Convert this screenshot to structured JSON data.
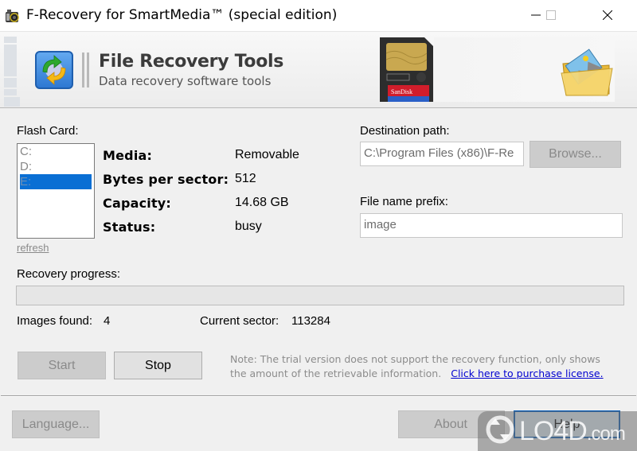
{
  "window": {
    "title": "F-Recovery for SmartMedia™ (special edition)",
    "app_icon": "camera-icon",
    "controls": [
      "minimize-icon",
      "maximize-icon",
      "close-icon"
    ]
  },
  "banner": {
    "brand_title": "File Recovery Tools",
    "brand_subtitle": "Data recovery software tools",
    "logo_icon": "recovery-arrows-icon",
    "card_icon": "smartmedia-card-icon",
    "card_text": "SanDisk",
    "folder_icon": "image-folder-icon"
  },
  "flash_card": {
    "label": "Flash Card:",
    "drives": [
      {
        "label": "C:",
        "selected": false
      },
      {
        "label": "D:",
        "selected": false
      },
      {
        "label": "E:",
        "selected": true
      }
    ],
    "refresh_label": "refresh"
  },
  "properties": [
    {
      "key": "Media:",
      "value": "Removable"
    },
    {
      "key": "Bytes per sector:",
      "value": "512"
    },
    {
      "key": "Capacity:",
      "value": "14.68 GB"
    },
    {
      "key": "Status:",
      "value": "busy"
    }
  ],
  "destination": {
    "label": "Destination path:",
    "value": "C:\\Program Files (x86)\\F-Re",
    "browse_label": "Browse..."
  },
  "prefix": {
    "label": "File name prefix:",
    "value": "image"
  },
  "progress": {
    "label": "Recovery progress:",
    "percent": 0
  },
  "stats": {
    "images_found_label": "Images found:",
    "images_found_value": "4",
    "current_sector_label": "Current sector:",
    "current_sector_value": "113284"
  },
  "actions": {
    "start_label": "Start",
    "stop_label": "Stop"
  },
  "note": {
    "line1": "Note: The trial version does not support the recovery function, only shows",
    "line2": "the amount of the retrievable information.",
    "link": "Click here to purchase license."
  },
  "footer": {
    "language_label": "Language...",
    "about_label": "About",
    "help_label": "Help"
  },
  "watermark": {
    "text": "LO4D",
    "suffix": ".com"
  },
  "colors": {
    "selection": "#0a6fd4",
    "link": "#0000d0",
    "default_button_border": "#0a5cb4"
  }
}
